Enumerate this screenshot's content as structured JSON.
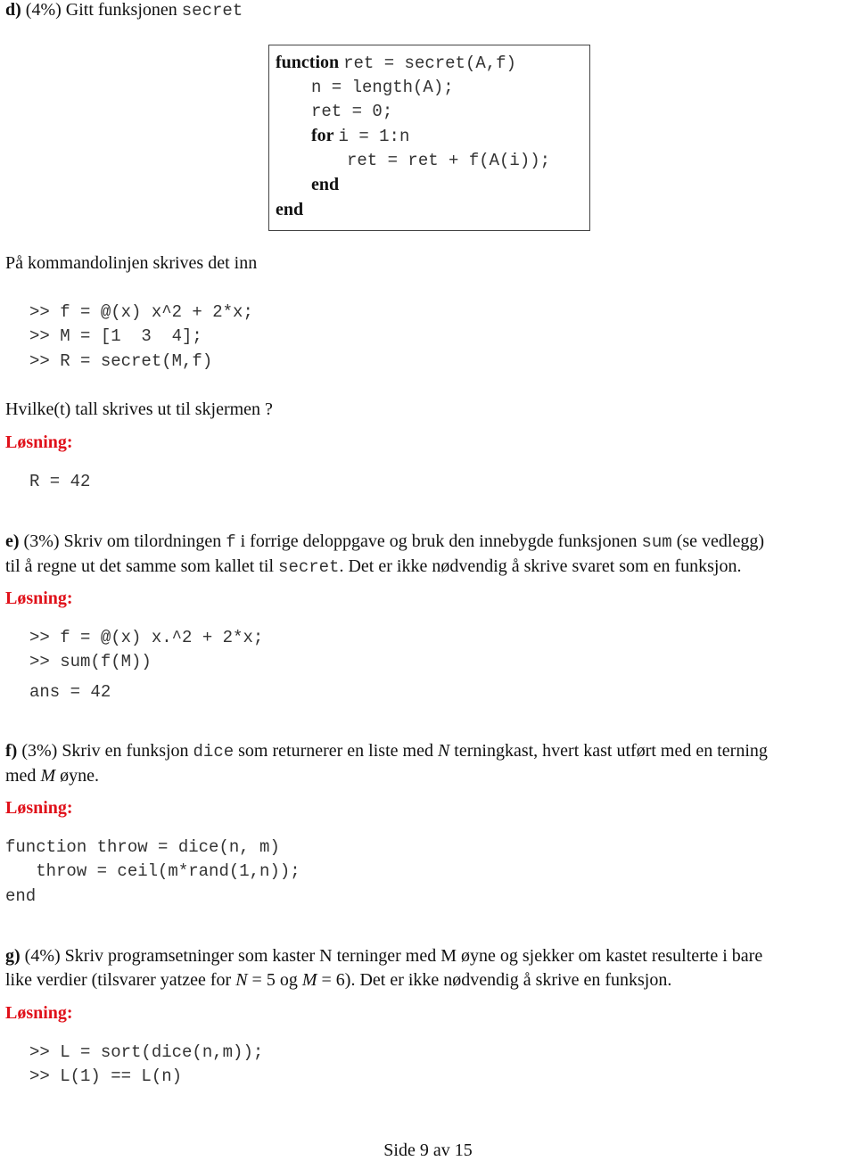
{
  "d": {
    "label": "d)",
    "weight": "(4%)",
    "text": "Gitt funksjonen",
    "func_name": "secret",
    "code": {
      "kw_function": "function",
      "sig": "ret = secret(A,f)",
      "l1": "n = length(A);",
      "l2": "ret = 0;",
      "kw_for": "for",
      "for_rest": "i = 1:n",
      "l4": "ret = ret + f(A(i));",
      "kw_end_inner": "end",
      "kw_end_outer": "end"
    },
    "intro": "På kommandolinjen skrives det inn",
    "commands": [
      ">> f = @(x) x^2 + 2*x;",
      ">> M = [1  3  4];",
      ">> R = secret(M,f)"
    ],
    "question": "Hvilke(t) tall skrives ut til skjermen ?",
    "solution_label": "Løsning:",
    "answer": "R = 42"
  },
  "e": {
    "label": "e)",
    "weight": "(3%)",
    "t1": "Skriv om tilordningen",
    "f": "f",
    "t2": "i forrige deloppgave og bruk den innebygde funksjonen",
    "sum": "sum",
    "t3": "(se vedlegg)",
    "t4": "til å regne ut det samme som kallet til",
    "secret": "secret",
    "t5": ". Det er ikke nødvendig å skrive svaret som en funksjon.",
    "solution_label": "Løsning:",
    "code": [
      ">> f = @(x) x.^2 + 2*x;",
      ">> sum(f(M))"
    ],
    "answer": "ans = 42"
  },
  "f": {
    "label": "f)",
    "weight": "(3%)",
    "t1": "Skriv en funksjon",
    "dice": "dice",
    "t2": "som returnerer en liste med",
    "N": "N",
    "t3": "terningkast, hvert kast utført med en terning",
    "t4": "med",
    "M": "M",
    "t5": "øyne.",
    "solution_label": "Løsning:",
    "code": [
      "function throw = dice(n, m)",
      "   throw = ceil(m*rand(1,n));",
      "end"
    ]
  },
  "g": {
    "label": "g)",
    "weight": "(4%)",
    "t1": "Skriv programsetninger som kaster N terninger med M øyne og sjekker om kastet resulterte i bare",
    "t2": "like verdier (tilsvarer yatzee for",
    "N": "N",
    "eq5": " = 5 og ",
    "M": "M",
    "eq6": " = 6). Det er ikke nødvendig å skrive en funksjon.",
    "solution_label": "Løsning:",
    "code": [
      ">> L = sort(dice(n,m));",
      ">> L(1) == L(n)"
    ]
  },
  "footer": "Side 9 av 15"
}
